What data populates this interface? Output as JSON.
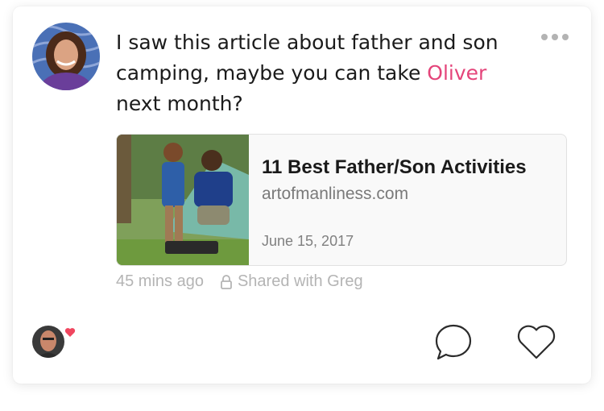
{
  "post": {
    "message_before": "I saw this article about father and son camping, maybe you can take ",
    "mention": "Oliver",
    "message_after": " next month?",
    "icons": {
      "more": "more-horizontal-icon"
    }
  },
  "link_preview": {
    "title": "11 Best Father/Son Activities",
    "domain": "artofmanliness.com",
    "date": "June 15, 2017"
  },
  "meta": {
    "time": "45 mins ago",
    "privacy": "Shared with Greg",
    "icon": "lock-icon"
  },
  "reactions": {
    "icons": {
      "reaction": "heart-badge-icon",
      "comment": "comment-icon",
      "like": "heart-outline-icon"
    }
  },
  "colors": {
    "mention": "#e4447a",
    "reaction_heart": "#f0465f",
    "meta_text": "#b4b4b4"
  }
}
